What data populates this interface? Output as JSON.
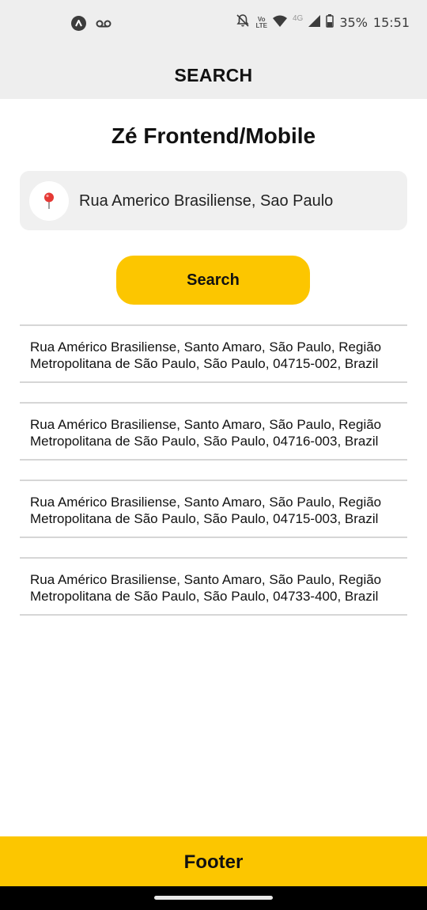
{
  "status_bar": {
    "battery": "35%",
    "time": "15:51",
    "volte_top": "Vo",
    "volte_bottom": "LTE",
    "network": "4G",
    "icons": [
      "app-icon",
      "voicemail-icon",
      "bell-off-icon",
      "volte-icon",
      "wifi-icon",
      "signal-icon",
      "battery-icon"
    ]
  },
  "header": {
    "title": "SEARCH"
  },
  "main": {
    "title": "Zé Frontend/Mobile",
    "search": {
      "value": "Rua Americo Brasiliense, Sao Paulo",
      "icon": "map-pin-icon"
    },
    "search_button": "Search",
    "results": [
      {
        "line1": "Rua Américo Brasiliense, Santo Amaro, São Paulo, Região",
        "line2": "Metropolitana de São Paulo, São Paulo, 04715-002, Brazil"
      },
      {
        "line1": "Rua Américo Brasiliense, Santo Amaro, São Paulo, Região",
        "line2": "Metropolitana de São Paulo, São Paulo, 04716-003, Brazil"
      },
      {
        "line1": "Rua Américo Brasiliense, Santo Amaro, São Paulo, Região",
        "line2": "Metropolitana de São Paulo, São Paulo, 04715-003, Brazil"
      },
      {
        "line1": "Rua Américo Brasiliense, Santo Amaro, São Paulo, Região",
        "line2": "Metropolitana de São Paulo, São Paulo, 04733-400, Brazil"
      }
    ]
  },
  "footer": {
    "label": "Footer"
  },
  "colors": {
    "accent": "#fcc600",
    "header_bg": "#eeeeee",
    "search_bg": "#f0f0f0",
    "pin": "#e53935"
  }
}
